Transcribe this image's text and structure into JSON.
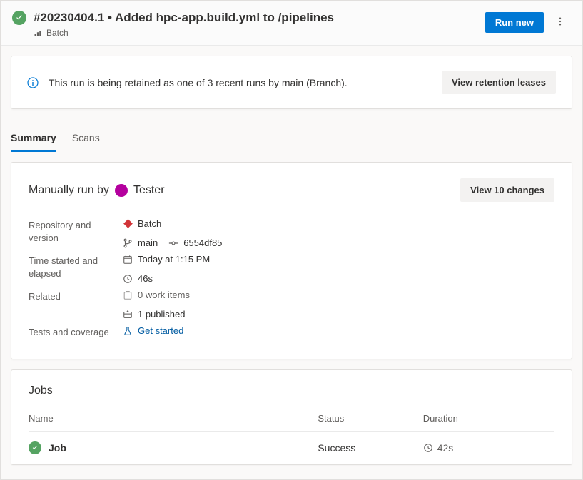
{
  "header": {
    "title": "#20230404.1 • Added hpc-app.build.yml to /pipelines",
    "queue": "Batch",
    "run_new_label": "Run new"
  },
  "retention": {
    "message": "This run is being retained as one of 3 recent runs by main (Branch).",
    "button_label": "View retention leases"
  },
  "tabs": {
    "summary": "Summary",
    "scans": "Scans"
  },
  "run": {
    "title_prefix": "Manually run by",
    "runner_name": "Tester",
    "changes_button": "View 10 changes",
    "labels": {
      "repo": "Repository and version",
      "time": "Time started and elapsed",
      "related": "Related",
      "tests": "Tests and coverage"
    },
    "repo_name": "Batch",
    "branch": "main",
    "commit": "6554df85",
    "started": "Today at 1:15 PM",
    "elapsed": "46s",
    "work_items": "0 work items",
    "published": "1 published",
    "tests_link": "Get started"
  },
  "jobs": {
    "title": "Jobs",
    "cols": {
      "name": "Name",
      "status": "Status",
      "duration": "Duration"
    },
    "rows": [
      {
        "name": "Job",
        "status": "Success",
        "duration": "42s"
      }
    ]
  }
}
